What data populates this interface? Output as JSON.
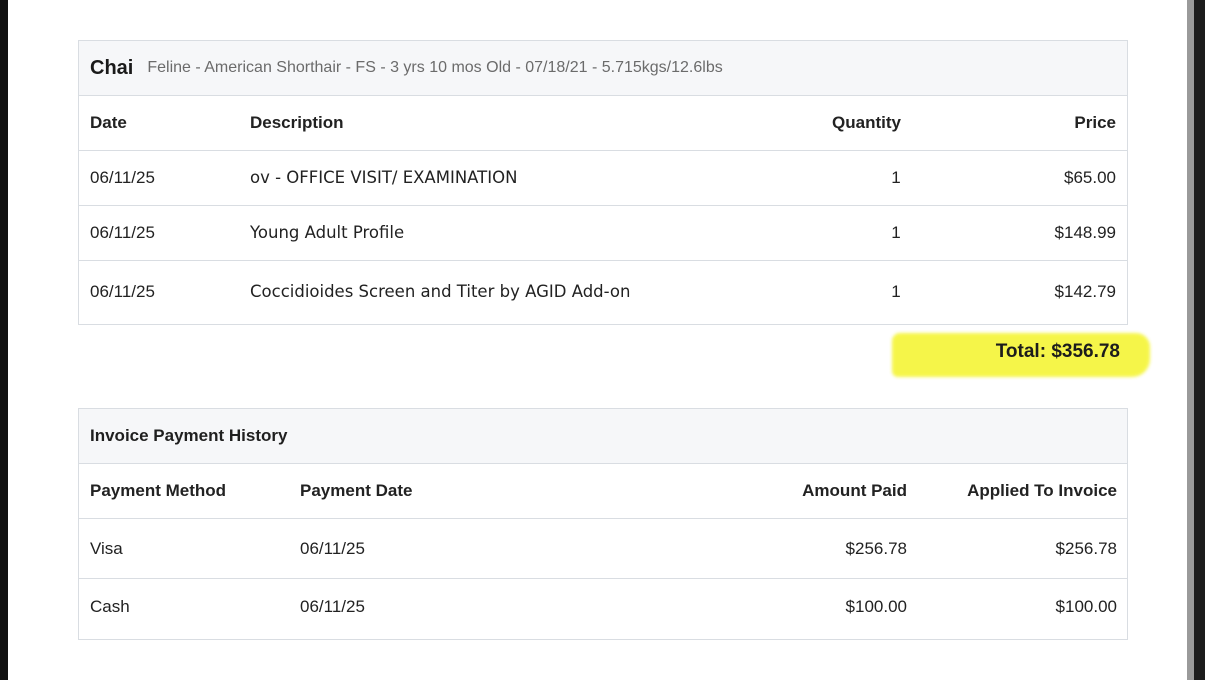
{
  "patient": {
    "name": "Chai",
    "info": "Feline - American Shorthair - FS - 3 yrs 10 mos Old - 07/18/21 - 5.715kgs/12.6lbs"
  },
  "invoice_table": {
    "headers": {
      "date": "Date",
      "description": "Description",
      "quantity": "Quantity",
      "price": "Price"
    },
    "rows": [
      {
        "date": "06/11/25",
        "description": "ov - OFFICE VISIT/ EXAMINATION",
        "quantity": "1",
        "price": "$65.00"
      },
      {
        "date": "06/11/25",
        "description": "Young Adult Profile",
        "quantity": "1",
        "price": "$148.99"
      },
      {
        "date": "06/11/25",
        "description": "Coccidioides Screen and Titer by AGID Add-on",
        "quantity": "1",
        "price": "$142.79"
      }
    ]
  },
  "total": {
    "label": "Total: $356.78"
  },
  "payment_history": {
    "title": "Invoice Payment History",
    "headers": {
      "method": "Payment Method",
      "date": "Payment Date",
      "amount": "Amount Paid",
      "applied": "Applied To Invoice"
    },
    "rows": [
      {
        "method": "Visa",
        "date": "06/11/25",
        "amount": "$256.78",
        "applied": "$256.78"
      },
      {
        "method": "Cash",
        "date": "06/11/25",
        "amount": "$100.00",
        "applied": "$100.00"
      }
    ]
  },
  "colors": {
    "highlight": "#f5f53a",
    "border": "#d9dde2",
    "header_background": "#f6f7f9"
  }
}
